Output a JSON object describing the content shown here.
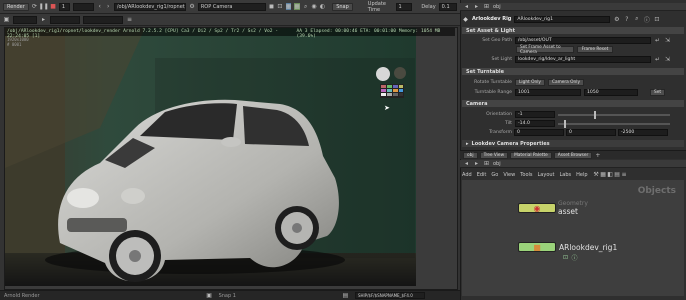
{
  "toolbar": {
    "render_menu": "Render",
    "frame_value": "1",
    "rop_path": "/obj/ARlookdev_rig1/ropnet/lookdev_render",
    "camera": "ROP Camera",
    "snap_label": "Snap",
    "update_time_label": "Update Time",
    "update_time_value": "1",
    "delay_label": "Delay",
    "delay_value": "0.1"
  },
  "hud": {
    "left": "/obj/ARlookdev_rig1/ropnet/lookdev_render  Arnold 7.2.5.2 [CPU] Ca3 / Di2 / Sp2 / Tr2 / Ss2 / Vo2 - 22:24:05 [1]",
    "right": "AA 3    Elapsed: 00:00:46    ETA: 00:01:00    Memory: 1054 MB    (39.6%)",
    "line2": "1920x1080",
    "line3": "# 0001"
  },
  "status": {
    "left_label": "Arnold Render",
    "mid_label": "Snap 1",
    "right_text": "SHIP/$F/$SNAPNAME_$F4.0"
  },
  "param_panel": {
    "node_type": "Arlookdev Rig",
    "node_name": "ARlookdev_rig1",
    "section_asset": "Set Asset & Light",
    "set_geo_path_label": "Set Geo Path",
    "set_geo_path_value": "/obj/asset/OUT",
    "btn_set_frame_asset": "Set Frame Asset to Camera",
    "btn_frame_reset": "Frame Reset",
    "set_light_label": "Set Light",
    "set_light_value": "lookdev_rig/ldev_ar_light",
    "section_turntable": "Set Turntable",
    "rotate_turntable_label": "Rotate Turntable",
    "light_only": "Light Only",
    "camera_only": "Camera Only",
    "turntable_range_label": "Turntable Range",
    "turntable_start": "1001",
    "turntable_end": "1050",
    "set_button": "Set",
    "section_camera": "Camera",
    "orientation_label": "Orientation",
    "orientation_value": "-1",
    "tilt_label": "Tilt",
    "tilt_value": "-14.0",
    "transform_label": "Transform",
    "transform_x": "0",
    "transform_y": "0",
    "transform_z": "-2500",
    "section_lookdev_camera": "Lookdev Camera Properties"
  },
  "network": {
    "tabs": [
      "obj",
      "Tree View",
      "Material Palette",
      "Asset Browser"
    ],
    "path": "obj",
    "menu": [
      "Add",
      "Edit",
      "Go",
      "View",
      "Tools",
      "Layout",
      "Labs",
      "Help"
    ],
    "context_label": "Objects",
    "nodes": [
      {
        "type": "Geometry",
        "name": "asset",
        "color": "#c7d36a"
      },
      {
        "type": "",
        "name": "ARlookdev_rig1",
        "color": "#9ad27a"
      }
    ]
  },
  "top_tab": "obj"
}
